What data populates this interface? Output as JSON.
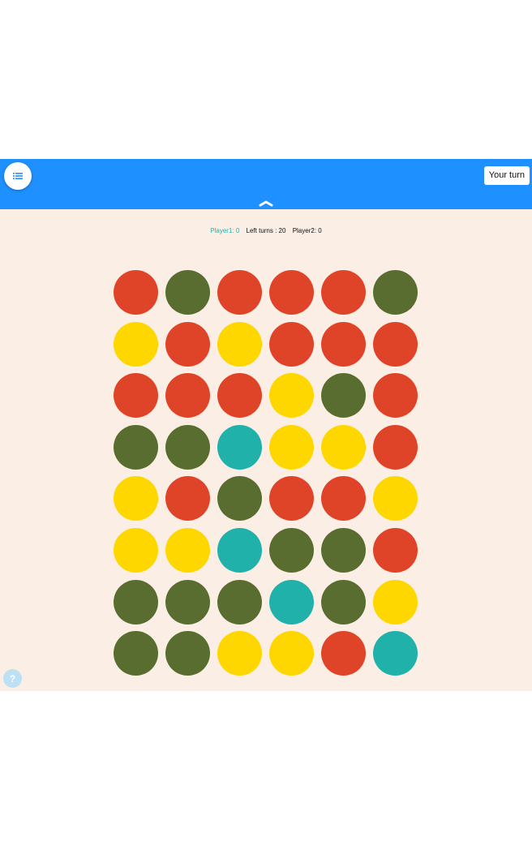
{
  "header": {
    "menu_icon": "list-icon",
    "turn_label": "Your turn",
    "collapse_icon": "chevron-up-icon",
    "color": "#1e90ff"
  },
  "score": {
    "player1": "Player1: 0",
    "left_turns": "Left turns : 20",
    "player2": "Player2: 0"
  },
  "colors": {
    "R": "#e04428",
    "G": "#596d30",
    "Y": "#ffd700",
    "T": "#20b2aa"
  },
  "board": [
    [
      "R",
      "G",
      "R",
      "R",
      "R",
      "G"
    ],
    [
      "Y",
      "R",
      "Y",
      "R",
      "R",
      "R"
    ],
    [
      "R",
      "R",
      "R",
      "Y",
      "G",
      "R"
    ],
    [
      "G",
      "G",
      "T",
      "Y",
      "Y",
      "R"
    ],
    [
      "Y",
      "R",
      "G",
      "R",
      "R",
      "Y"
    ],
    [
      "Y",
      "Y",
      "T",
      "G",
      "G",
      "R"
    ],
    [
      "G",
      "G",
      "G",
      "T",
      "G",
      "Y"
    ],
    [
      "G",
      "G",
      "Y",
      "Y",
      "R",
      "T"
    ]
  ],
  "help": {
    "label": "?"
  }
}
